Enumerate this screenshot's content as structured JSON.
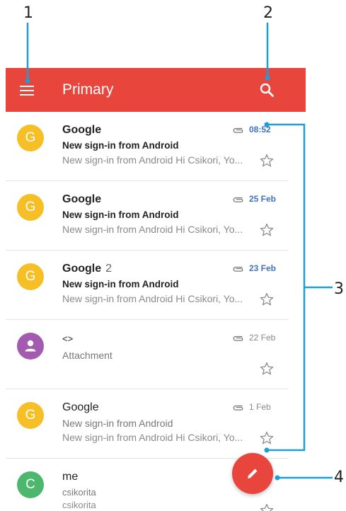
{
  "callouts": [
    "1",
    "2",
    "3",
    "4"
  ],
  "appbar": {
    "title": "Primary",
    "color": "#e8453c",
    "menu_icon": "menu-icon",
    "search_icon": "search-icon"
  },
  "emails": [
    {
      "avatar_letter": "G",
      "avatar_color": "#f6bf26",
      "sender": "Google",
      "count": "",
      "subject": "New sign-in from Android",
      "snippet": "New sign-in from Android Hi Csikori, Yo...",
      "date": "08:52",
      "unread": true,
      "has_attachment": true
    },
    {
      "avatar_letter": "G",
      "avatar_color": "#f6bf26",
      "sender": "Google",
      "count": "",
      "subject": "New sign-in from Android",
      "snippet": "New sign-in from Android Hi Csikori, Yo...",
      "date": "25 Feb",
      "unread": true,
      "has_attachment": true
    },
    {
      "avatar_letter": "G",
      "avatar_color": "#f6bf26",
      "sender": "Google",
      "count": "2",
      "subject": "New sign-in from Android",
      "snippet": "New sign-in from Android Hi Csikori, Yo...",
      "date": "23 Feb",
      "unread": true,
      "has_attachment": true
    },
    {
      "avatar_letter": "",
      "avatar_icon": "person-icon",
      "avatar_color": "#a35bb0",
      "sender": "<>",
      "count": "",
      "subject": "Attachment",
      "snippet": "",
      "date": "22 Feb",
      "unread": false,
      "has_attachment": true
    },
    {
      "avatar_letter": "G",
      "avatar_color": "#f6bf26",
      "sender": "Google",
      "count": "",
      "subject": "New sign-in from Android",
      "snippet": "New sign-in from Android Hi Csikori, Yo...",
      "date": "1 Feb",
      "unread": false,
      "has_attachment": true
    },
    {
      "avatar_letter": "C",
      "avatar_color": "#4cb86e",
      "sender": "me",
      "count": "",
      "subject": "csikorita",
      "snippet": "csikorita",
      "date": "",
      "unread": false,
      "has_attachment": false
    }
  ],
  "fab": {
    "icon": "pencil-icon",
    "color": "#e8453c"
  },
  "colors": {
    "unread_date": "#3e73c4",
    "callout_line": "#1a9fd8"
  }
}
